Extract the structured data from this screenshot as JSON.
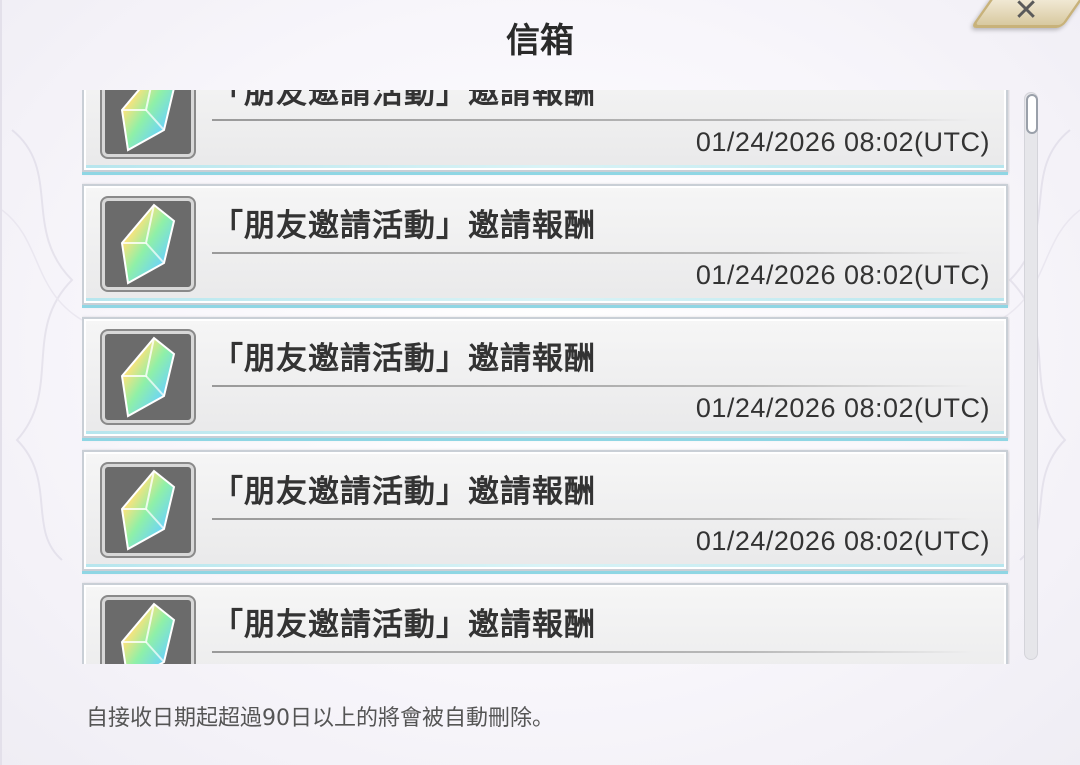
{
  "window": {
    "title": "信箱",
    "close_label": "✕"
  },
  "mail_list": {
    "items": [
      {
        "title": "「朋友邀請活動」邀請報酬",
        "date": "01/24/2026 08:02(UTC)",
        "icon": "rainbow-crystal-icon"
      },
      {
        "title": "「朋友邀請活動」邀請報酬",
        "date": "01/24/2026 08:02(UTC)",
        "icon": "rainbow-crystal-icon"
      },
      {
        "title": "「朋友邀請活動」邀請報酬",
        "date": "01/24/2026 08:02(UTC)",
        "icon": "rainbow-crystal-icon"
      },
      {
        "title": "「朋友邀請活動」邀請報酬",
        "date": "01/24/2026 08:02(UTC)",
        "icon": "rainbow-crystal-icon"
      },
      {
        "title": "「朋友邀請活動」邀請報酬",
        "date": "",
        "icon": "rainbow-crystal-icon"
      }
    ]
  },
  "footer": {
    "note": "自接收日期起超過90日以上的將會被自動刪除。"
  },
  "colors": {
    "item_accent": "#8fd6e4",
    "icon_bg": "#6b6b6b",
    "close_gold": "#c8b27a"
  }
}
